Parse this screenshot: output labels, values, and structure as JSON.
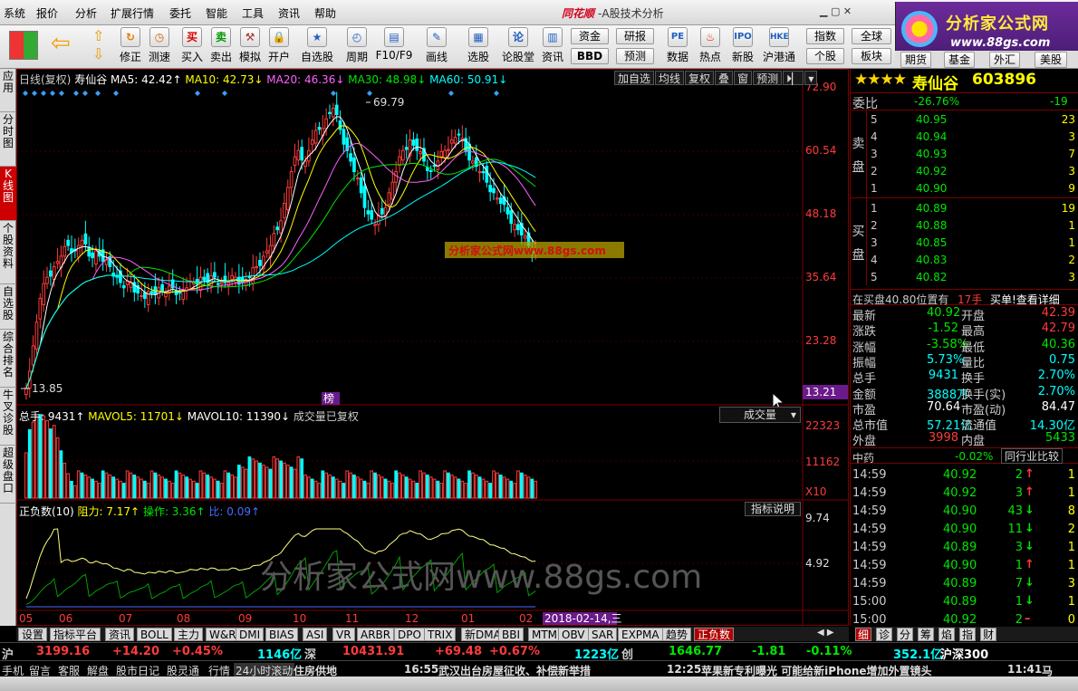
{
  "menu": [
    "系统",
    "报价",
    "分析",
    "扩展行情",
    "委托",
    "智能",
    "工具",
    "资讯",
    "帮助"
  ],
  "app_brand": "同花顺",
  "app_title": "A股技术分析",
  "logo": {
    "line1": "分析家公式网",
    "line2": "www.88gs.com"
  },
  "toolbar": {
    "buttons": [
      "修正",
      "测速",
      "买入",
      "卖出",
      "模拟",
      "开户",
      "自选股",
      "周期",
      "F10/F9",
      "画线",
      "选股",
      "论股堂",
      "资讯",
      "数据",
      "热点",
      "新股",
      "沪港通"
    ],
    "small": [
      "资金",
      "BBD",
      "研报",
      "预测",
      "指数",
      "个股",
      "全球",
      "板块",
      "港股",
      "期货",
      "基金",
      "外汇",
      "美股"
    ]
  },
  "side_tabs": [
    "应用",
    "分时图",
    "K线图",
    "个股资料",
    "自选股",
    "综合排名",
    "牛叉诊股",
    "超级盘口"
  ],
  "chart_header": {
    "period": "日线(复权)",
    "stock": "寿仙谷",
    "ma5": "MA5: 42.42↑",
    "ma10": "MA10: 42.73↓",
    "ma20": "MA20: 46.36↓",
    "ma30": "MA30: 48.98↓",
    "ma60": "MA60: 50.91↓"
  },
  "chart_tools": [
    "加自选",
    "均线",
    "复权",
    "叠",
    "窗",
    "预测"
  ],
  "watermark_small": "分析家公式网www.88gs.com",
  "watermark_big": "分析家公式网www.88gs.com",
  "bang_label": "榜",
  "y_labels": [
    "72.90",
    "60.54",
    "48.18",
    "35.64",
    "23.28",
    "13.21"
  ],
  "vol_header": {
    "total": "总手: 9431↑",
    "mavol5": "MAVOL5: 11701↓",
    "mavol10": "MAVOL10: 11390↓",
    "note": "成交量已复权",
    "select": "成交量"
  },
  "vol_labels": [
    "22323",
    "11162",
    "X10"
  ],
  "ind_header": {
    "name": "正负数(10)",
    "zl": "阻力: 7.17↑",
    "cz": "操作: 3.36↑",
    "bi": "比: 0.09↑",
    "help": "指标说明"
  },
  "ind_labels": [
    "9.74",
    "4.92"
  ],
  "x_labels": [
    "05",
    "06",
    "07",
    "08",
    "09",
    "10",
    "11",
    "12",
    "01",
    "02"
  ],
  "x_cursor_date": "2018-02-14,三",
  "chart_data": {
    "type": "candlestick",
    "title": "寿仙谷",
    "ylim": [
      13.21,
      72.9
    ],
    "high_label": "69.79",
    "low_label": "13.85",
    "close_path": [
      15,
      23,
      32,
      36,
      38,
      40,
      42,
      41,
      43,
      40,
      41,
      39,
      38,
      36,
      34,
      35,
      33,
      32,
      33,
      34,
      33,
      34,
      33,
      34,
      35,
      36,
      35,
      36,
      35,
      35,
      36,
      35,
      36,
      38,
      40,
      42,
      45,
      50,
      56,
      60,
      58,
      62,
      64,
      66,
      68,
      64,
      60,
      56,
      52,
      48,
      46,
      48,
      52,
      56,
      60,
      62,
      60,
      58,
      56,
      58,
      60,
      62,
      63,
      60,
      58,
      56,
      54,
      52,
      50,
      48,
      46,
      44,
      42,
      41
    ]
  },
  "quote": {
    "stars": "★★★★",
    "name": "寿仙谷",
    "code": "603896",
    "webi_label": "委比",
    "webi": "-26.76%",
    "webi_diff": "-19",
    "sell": [
      [
        "5",
        "40.95",
        "23"
      ],
      [
        "4",
        "40.94",
        "3"
      ],
      [
        "3",
        "40.93",
        "7"
      ],
      [
        "2",
        "40.92",
        "3"
      ],
      [
        "1",
        "40.90",
        "9"
      ]
    ],
    "buy": [
      [
        "1",
        "40.89",
        "19"
      ],
      [
        "2",
        "40.88",
        "1"
      ],
      [
        "3",
        "40.85",
        "1"
      ],
      [
        "4",
        "40.83",
        "2"
      ],
      [
        "5",
        "40.82",
        "3"
      ]
    ],
    "sell_label": [
      "卖",
      "盘"
    ],
    "buy_label": [
      "买",
      "盘"
    ],
    "queue": "在买盘40.80位置有",
    "queue_qty": "17手",
    "queue_link": "买单!查看详细",
    "stats": [
      [
        "最新",
        "40.92",
        "开盘",
        "42.39"
      ],
      [
        "涨跌",
        "-1.52",
        "最高",
        "42.79"
      ],
      [
        "涨幅",
        "-3.58%",
        "最低",
        "40.36"
      ],
      [
        "振幅",
        "5.73%",
        "量比",
        "0.75"
      ],
      [
        "总手",
        "9431",
        "换手",
        "2.70%"
      ],
      [
        "金额",
        "3888万",
        "换手(实)",
        "2.70%"
      ],
      [
        "市盈",
        "70.64",
        "市盈(动)",
        "84.47"
      ],
      [
        "总市值",
        "57.21亿",
        "流通值",
        "14.30亿"
      ],
      [
        "外盘",
        "3998",
        "内盘",
        "5433"
      ]
    ],
    "industry": "中药",
    "industry_pct": "-0.02%",
    "industry_btn": "同行业比较",
    "ticks": [
      [
        "14:59",
        "40.92",
        "2",
        "↑",
        "1"
      ],
      [
        "14:59",
        "40.92",
        "3",
        "↑",
        "1"
      ],
      [
        "14:59",
        "40.90",
        "43",
        "↓",
        "8"
      ],
      [
        "14:59",
        "40.90",
        "11",
        "↓",
        "2"
      ],
      [
        "14:59",
        "40.89",
        "3",
        "↓",
        "1"
      ],
      [
        "14:59",
        "40.90",
        "1",
        "↑",
        "1"
      ],
      [
        "14:59",
        "40.89",
        "7",
        "↓",
        "3"
      ],
      [
        "15:00",
        "40.89",
        "1",
        "↓",
        "1"
      ],
      [
        "15:00",
        "40.92",
        "2",
        "–",
        "0"
      ]
    ]
  },
  "bottom_tabs": [
    "设置",
    "指标平台",
    "资讯",
    "BOLL",
    "主力",
    "W&R",
    "DMI",
    "BIAS",
    "ASI",
    "VR",
    "ARBR",
    "DPO",
    "TRIX",
    "新DMA",
    "BBI",
    "MTM",
    "OBV",
    "SAR",
    "EXPMA",
    "趋势",
    "正负数"
  ],
  "right_tabs": [
    "细",
    "诊",
    "分",
    "筹",
    "焰",
    "指",
    "财"
  ],
  "index_bar": {
    "sh_label": "沪",
    "sh": "3199.16",
    "sh_chg": "+14.20",
    "sh_pct": "+0.45%",
    "sh_amt": "1146亿",
    "sz_label": "深",
    "sz": "10431.91",
    "sz_chg": "+69.48",
    "sz_pct": "+0.67%",
    "sz_amt": "1223亿",
    "cy_label": "创",
    "cy": "1646.77",
    "cy_chg": "-1.81",
    "cy_pct": "-0.11%",
    "cy_amt": "352.1亿",
    "hs": "沪深300"
  },
  "status": {
    "items": [
      "手机",
      "留言",
      "客服",
      "解盘",
      "股市日记",
      "股灵通",
      "行情"
    ],
    "scroll_label": "24小时滚动",
    "n1": "住房供地",
    "n2_time": "16:55",
    "n2": "武汉出台房屋征收、补偿新举措",
    "n3_time": "12:25",
    "n3": "苹果新专利曝光 可能给新iPhone增加外置镜头",
    "n4_time": "11:41",
    "n4": "马"
  }
}
